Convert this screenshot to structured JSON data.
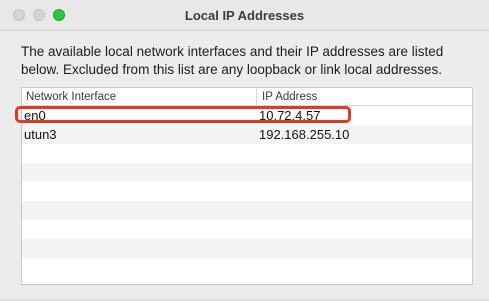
{
  "window": {
    "title": "Local IP Addresses"
  },
  "description": "The available local network interfaces and their IP addresses are listed below.  Excluded from this list are any loopback or link local addresses.",
  "table": {
    "columns": [
      "Network Interface",
      "IP Address"
    ],
    "rows": [
      {
        "interface": "en0",
        "ip": "10.72.4.57"
      },
      {
        "interface": "utun3",
        "ip": "192.168.255.10"
      },
      {
        "interface": "",
        "ip": ""
      },
      {
        "interface": "",
        "ip": ""
      },
      {
        "interface": "",
        "ip": ""
      },
      {
        "interface": "",
        "ip": ""
      },
      {
        "interface": "",
        "ip": ""
      },
      {
        "interface": "",
        "ip": ""
      },
      {
        "interface": "",
        "ip": ""
      }
    ]
  },
  "colors": {
    "highlight": "#e5381f",
    "zoom_button": "#28c840"
  }
}
